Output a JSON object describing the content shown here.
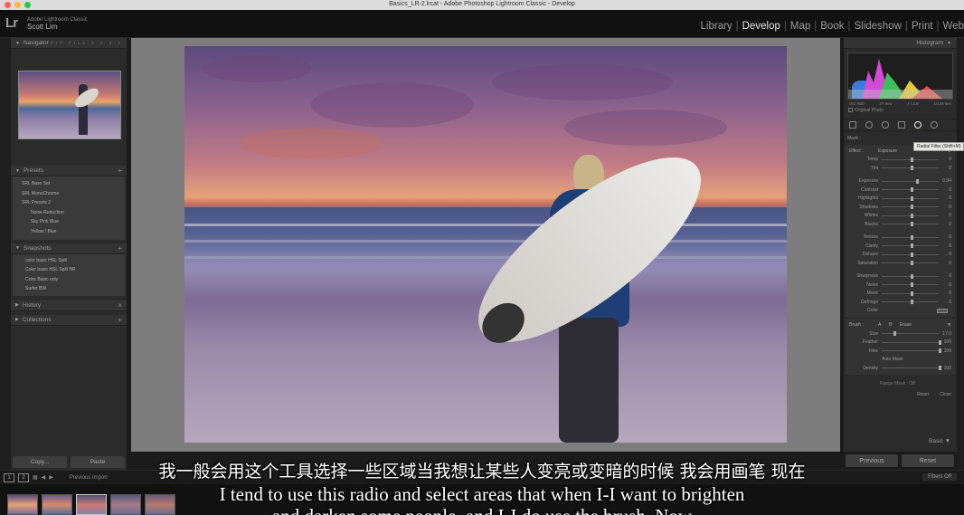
{
  "window": {
    "title": "Basics_LR-2.lrcat - Adobe Photoshop Lightroom Classic - Develop"
  },
  "identity": {
    "app": "Adobe Lightroom Classic",
    "user": "Scott Lim",
    "logo": "Lr"
  },
  "modules": [
    "Library",
    "Develop",
    "Map",
    "Book",
    "Slideshow",
    "Print",
    "Web"
  ],
  "active_module": "Develop",
  "left": {
    "navigator": {
      "title": "Navigator",
      "options": "FIT  FILL  1:1  3:1"
    },
    "presets": {
      "title": "Presets",
      "items": [
        {
          "label": "SRL Base Set",
          "sub": false
        },
        {
          "label": "SRL MonoChrome",
          "sub": false
        },
        {
          "label": "SRL Presets 2",
          "sub": false
        },
        {
          "label": "Noise Reduction",
          "sub": true
        },
        {
          "label": "Sky Pink Blue",
          "sub": true
        },
        {
          "label": "Yellow / Blue",
          "sub": true
        }
      ]
    },
    "snapshots": {
      "title": "Snapshots",
      "items": [
        "color basic HSL Split",
        "Color basic HSL Split NR",
        "Color Basic only",
        "Surfer BW"
      ]
    },
    "history": {
      "title": "History"
    },
    "collections": {
      "title": "Collections"
    },
    "buttons": {
      "copy": "Copy...",
      "paste": "Paste"
    }
  },
  "right": {
    "histogram": {
      "title": "Histogram",
      "iso": "ISO 800",
      "focal": "27 mm",
      "aperture": "ƒ / 2.8",
      "shutter": "1/125 sec"
    },
    "original_photo": "Original Photo",
    "tooltip": "Radial Filter (Shift+M)",
    "mask_label": "Mask :",
    "effect": {
      "label": "Effect :",
      "value": "Exposure"
    },
    "sliders": [
      {
        "label": "Temp",
        "value": "0",
        "pos": 0.5
      },
      {
        "label": "Tint",
        "value": "0",
        "pos": 0.5
      },
      {
        "label": "Exposure",
        "value": "0.84",
        "pos": 0.6
      },
      {
        "label": "Contrast",
        "value": "0",
        "pos": 0.5
      },
      {
        "label": "Highlights",
        "value": "0",
        "pos": 0.5
      },
      {
        "label": "Shadows",
        "value": "0",
        "pos": 0.5
      },
      {
        "label": "Whites",
        "value": "0",
        "pos": 0.5
      },
      {
        "label": "Blacks",
        "value": "0",
        "pos": 0.5
      },
      {
        "label": "Texture",
        "value": "0",
        "pos": 0.5
      },
      {
        "label": "Clarity",
        "value": "0",
        "pos": 0.5
      },
      {
        "label": "Dehaze",
        "value": "0",
        "pos": 0.5
      },
      {
        "label": "Saturation",
        "value": "0",
        "pos": 0.5
      },
      {
        "label": "Sharpness",
        "value": "0",
        "pos": 0.5
      },
      {
        "label": "Noise",
        "value": "0",
        "pos": 0.5
      },
      {
        "label": "Moiré",
        "value": "0",
        "pos": 0.5
      },
      {
        "label": "Defringe",
        "value": "0",
        "pos": 0.5
      }
    ],
    "color_label": "Color",
    "brush": {
      "label": "Brush :",
      "tabs": [
        "A",
        "B",
        "Erase"
      ],
      "sliders": [
        {
          "label": "Size",
          "value": "17.0",
          "pos": 0.2
        },
        {
          "label": "Feather",
          "value": "100",
          "pos": 1.0
        },
        {
          "label": "Flow",
          "value": "100",
          "pos": 1.0
        },
        {
          "label": "Density",
          "value": "100",
          "pos": 1.0
        }
      ],
      "auto_mask": "Auto Mask"
    },
    "range_mask": "Range Mask : Off",
    "reset_label": "Reset",
    "close_label": "Close",
    "basic": "Basic",
    "buttons": {
      "previous": "Previous",
      "reset": "Reset"
    }
  },
  "filmstrip": {
    "pages": [
      "1",
      "2"
    ],
    "source": "Previous Import",
    "filters": "Filters Off"
  },
  "subtitles": {
    "zh": "我一般会用这个工具选择一些区域当我想让某些人变亮或变暗的时候 我会用画笔 现在",
    "en": "I tend to use this radio and select areas that when I-I want to brighten",
    "en2": "and darken some people, and I-I do use the brush. Now"
  },
  "colors": {
    "accent": "#e6e6e6",
    "panel": "#2b2b2b",
    "background": "#1b1b1b"
  }
}
